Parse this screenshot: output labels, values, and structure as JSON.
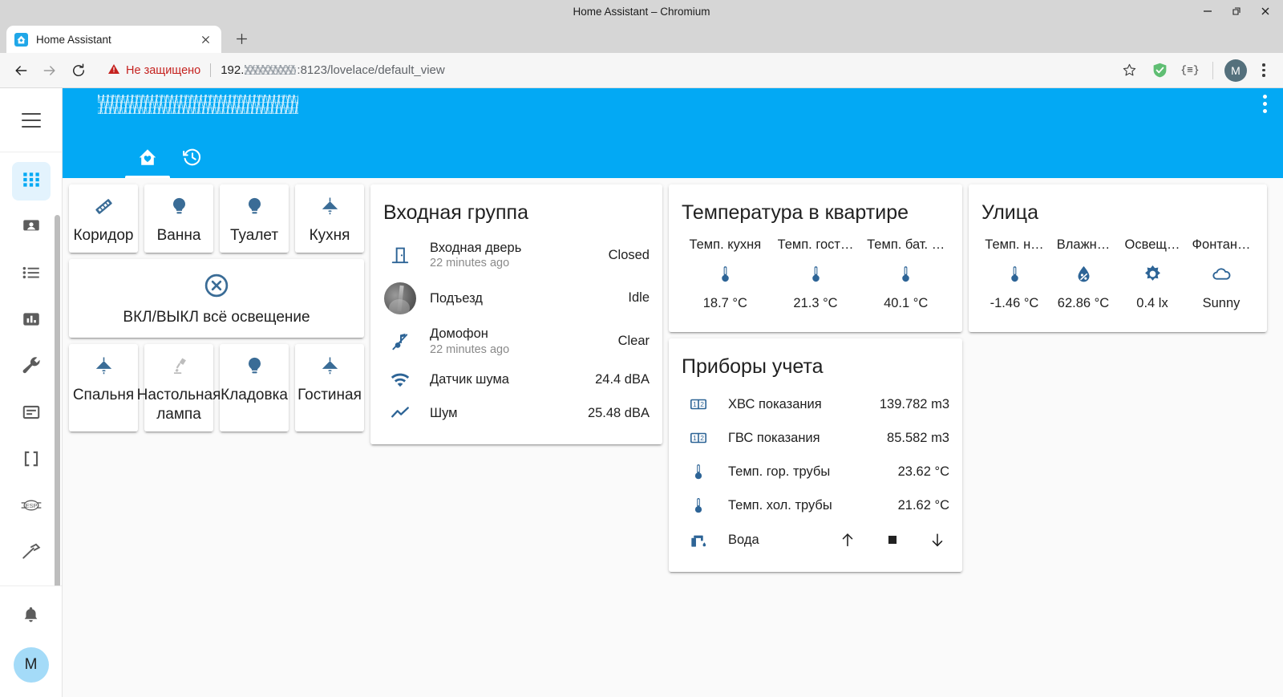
{
  "window": {
    "title": "Home Assistant – Chromium",
    "minimize_label": "–",
    "restore_label": "❐",
    "close_label": "✕"
  },
  "tab": {
    "title": "Home Assistant",
    "close_label": "✕",
    "newtab_label": "+"
  },
  "toolbar": {
    "back_label": "←",
    "forward_label": "→",
    "reload_label": "⟳",
    "security_text": "Не защищено",
    "url_prefix": "192.",
    "url_suffix": ":8123/lovelace/default_view",
    "bookmark_label": "☆",
    "extension_adblock": "adblock-shield-icon",
    "extension_other": "{≡}",
    "profile_initial": "M",
    "menu_label": "⋮"
  },
  "sidebar": {
    "hamburger": "menu-icon",
    "items": [
      {
        "name": "overview",
        "icon": "view-dashboard-icon",
        "active": true
      },
      {
        "name": "map",
        "icon": "map-marker-icon",
        "active": false
      },
      {
        "name": "logbook",
        "icon": "format-list-bulleted-icon",
        "active": false
      },
      {
        "name": "history",
        "icon": "chart-box-icon",
        "active": false
      },
      {
        "name": "supervisor",
        "icon": "wrench-icon",
        "active": false
      },
      {
        "name": "file-editor",
        "icon": "file-document-icon",
        "active": false
      },
      {
        "name": "terminal",
        "icon": "code-brackets-icon",
        "active": false
      },
      {
        "name": "esphome",
        "icon": "esp-icon",
        "active": false
      },
      {
        "name": "developer-tools",
        "icon": "hammer-icon",
        "active": false
      }
    ],
    "notifications_icon": "bell-icon",
    "user_initial": "M"
  },
  "ha_header": {
    "title_redacted": true,
    "kebab_label": "⋮",
    "tabs": [
      {
        "name": "home",
        "icon": "home-heart-icon",
        "selected": true
      },
      {
        "name": "history",
        "icon": "history-clock-icon",
        "selected": false
      }
    ]
  },
  "lights_card": {
    "row1": [
      {
        "label": "Коридор",
        "icon": "led-strip-icon",
        "state": "on"
      },
      {
        "label": "Ванна",
        "icon": "lightbulb-icon",
        "state": "on"
      },
      {
        "label": "Туалет",
        "icon": "lightbulb-icon",
        "state": "on"
      },
      {
        "label": "Кухня",
        "icon": "ceiling-light-icon",
        "state": "on"
      }
    ],
    "toggle_all": {
      "label": "ВКЛ/ВЫКЛ всё освещение",
      "icon": "close-circle-outline-icon",
      "state": "on"
    },
    "row2": [
      {
        "label": "Спальня",
        "icon": "ceiling-light-icon",
        "state": "on"
      },
      {
        "label": "Настольная лампа",
        "icon": "desk-lamp-icon",
        "state": "off"
      },
      {
        "label": "Кладовка",
        "icon": "lightbulb-icon",
        "state": "on"
      },
      {
        "label": "Гостиная",
        "icon": "ceiling-light-icon",
        "state": "on"
      }
    ]
  },
  "entrance_card": {
    "title": "Входная группа",
    "rows": [
      {
        "name": "Входная дверь",
        "secondary": "22 minutes ago",
        "value": "Closed",
        "icon": "door-icon"
      },
      {
        "name": "Подъезд",
        "secondary": "",
        "value": "Idle",
        "icon": "camera-thumbnail"
      },
      {
        "name": "Домофон",
        "secondary": "22 minutes ago",
        "value": "Clear",
        "icon": "music-note-off-icon"
      },
      {
        "name": "Датчик шума",
        "secondary": "",
        "value": "24.4 dBA",
        "icon": "wifi-icon"
      },
      {
        "name": "Шум",
        "secondary": "",
        "value": "25.48 dBA",
        "icon": "chart-line-icon"
      }
    ]
  },
  "temperature_card": {
    "title": "Температура в квартире",
    "items": [
      {
        "name": "Темп. кухня",
        "icon": "thermometer-icon",
        "value": "18.7 °C"
      },
      {
        "name": "Темп. гост…",
        "icon": "thermometer-icon",
        "value": "21.3 °C"
      },
      {
        "name": "Темп. бат. …",
        "icon": "thermometer-icon",
        "value": "40.1 °C"
      }
    ]
  },
  "street_card": {
    "title": "Улица",
    "items": [
      {
        "name": "Темп. н…",
        "icon": "thermometer-icon",
        "value": "-1.46 °C"
      },
      {
        "name": "Влажн…",
        "icon": "water-percent-icon",
        "value": "62.86 °C"
      },
      {
        "name": "Освещ…",
        "icon": "brightness-icon",
        "value": "0.4 lx"
      },
      {
        "name": "Фонтан…",
        "icon": "weather-cloudy-icon",
        "value": "Sunny"
      }
    ]
  },
  "meters_card": {
    "title": "Приборы учета",
    "rows": [
      {
        "name": "ХВС показания",
        "value": "139.782 m3",
        "icon": "counter-icon"
      },
      {
        "name": "ГВС показания",
        "value": "85.582 m3",
        "icon": "counter-icon"
      },
      {
        "name": "Темп. гор. трубы",
        "value": "23.62 °C",
        "icon": "thermometer-icon"
      },
      {
        "name": "Темп. хол. трубы",
        "value": "21.62 °C",
        "icon": "thermometer-icon"
      }
    ],
    "water_row": {
      "name": "Вода",
      "icon": "water-pump-icon",
      "controls": [
        {
          "name": "open",
          "icon": "arrow-up-icon"
        },
        {
          "name": "stop",
          "icon": "stop-square-icon"
        },
        {
          "name": "close",
          "icon": "arrow-down-icon"
        }
      ]
    }
  },
  "colors": {
    "ha_blue": "#03a9f4",
    "icon_active": "#3a6c96",
    "icon_inactive": "#bdbdbd",
    "insecure_red": "#c5221f",
    "page_bg": "#fafafa"
  }
}
